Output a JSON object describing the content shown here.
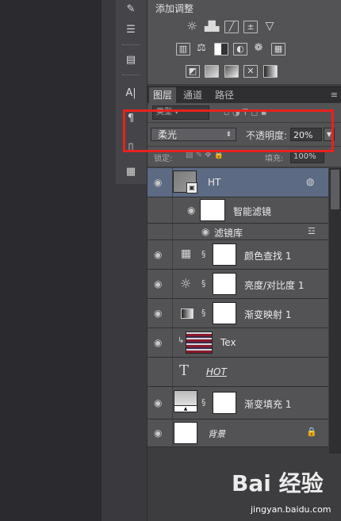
{
  "adjustments": {
    "title": "添加调整",
    "row1": [
      "brightness-contrast",
      "levels",
      "curves",
      "exposure",
      "vibrance"
    ],
    "row2": [
      "hue-saturation",
      "color-balance",
      "black-white",
      "photo-filter",
      "channel-mixer",
      "color-lookup"
    ],
    "row3": [
      "invert",
      "posterize",
      "threshold",
      "selective-color",
      "gradient-map"
    ]
  },
  "tabs": [
    {
      "label": "图层",
      "active": true
    },
    {
      "label": "通道",
      "active": false
    },
    {
      "label": "路径",
      "active": false
    }
  ],
  "filter": {
    "kind_label": "类型"
  },
  "blend": {
    "mode": "柔光",
    "opacity_label": "不透明度:",
    "opacity_value": "20%"
  },
  "lock": {
    "lock_label": "锁定:",
    "fill_label": "填充:",
    "fill_value": "100%"
  },
  "layers": [
    {
      "name": "HT",
      "type": "smart-object",
      "selected": true
    },
    {
      "name": "智能滤镜",
      "type": "smart-filter-mask"
    },
    {
      "name": "滤镜库",
      "type": "filter-entry"
    },
    {
      "name": "颜色查找 1",
      "type": "adjustment",
      "icon": "grid-icon"
    },
    {
      "name": "亮度/对比度 1",
      "type": "adjustment",
      "icon": "sun-icon"
    },
    {
      "name": "渐变映射 1",
      "type": "adjustment",
      "icon": "gradient-map-icon"
    },
    {
      "name": "Tex",
      "type": "image-clipped"
    },
    {
      "name": "HOT",
      "type": "text"
    },
    {
      "name": "渐变填充 1",
      "type": "fill"
    },
    {
      "name": "背景",
      "type": "background"
    }
  ],
  "watermark": {
    "brand": "Bai 经验",
    "url": "jingyan.baidu.com"
  },
  "colors": {
    "highlight": "#e8221c",
    "selected_layer": "#5c6a83"
  }
}
